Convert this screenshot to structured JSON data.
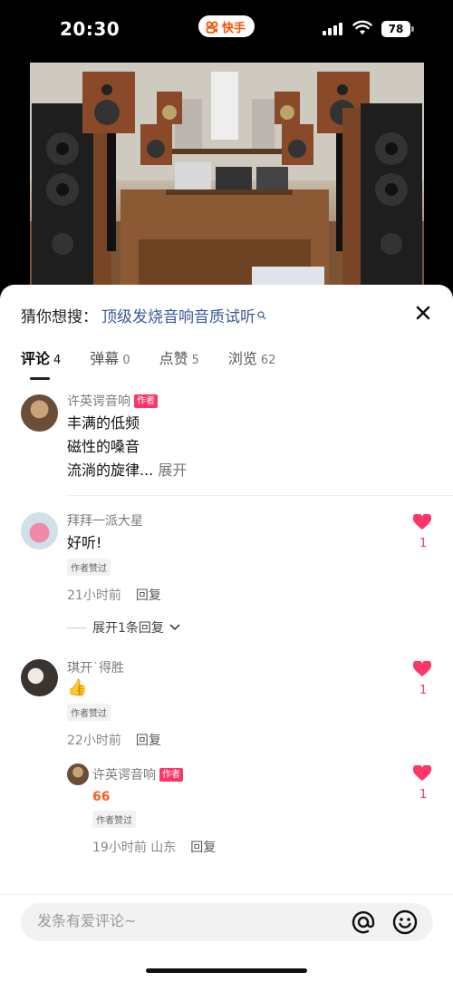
{
  "status_bar": {
    "time": "20:30",
    "app_badge": "快手",
    "battery": "78",
    "icons": [
      "signal-icon",
      "wifi-icon",
      "battery-icon"
    ]
  },
  "video": {
    "description_icon": "audio-speakers-photo"
  },
  "sheet": {
    "suggest_prefix": "猜你想搜：",
    "suggest_query": "顶级发烧音响音质试听",
    "tabs": [
      {
        "label": "评论",
        "count": "4"
      },
      {
        "label": "弹幕",
        "count": "0"
      },
      {
        "label": "点赞",
        "count": "5"
      },
      {
        "label": "浏览",
        "count": "62"
      }
    ]
  },
  "comments": [
    {
      "user": "许英谔音响",
      "author_tag": "作者",
      "lines": [
        "丰满的低频",
        "磁性的嗓音",
        "流淌的旋律..."
      ],
      "more": "展开"
    },
    {
      "user": "拜拜一派大星",
      "text": "好听!",
      "liked_tag": "作者赞过",
      "time": "21小时前",
      "reply": "回复",
      "likes": "1",
      "expand": "展开1条回复"
    },
    {
      "user": "琪开˙得胜",
      "text": "👍",
      "liked_tag": "作者赞过",
      "time": "22小时前",
      "reply": "回复",
      "likes": "1"
    },
    {
      "user": "许英谔音响",
      "author_tag": "作者",
      "text": "66",
      "liked_tag": "作者赞过",
      "time": "19小时前",
      "location": "山东",
      "reply": "回复",
      "likes": "1"
    }
  ],
  "input": {
    "placeholder": "发条有爱评论~"
  },
  "colors": {
    "accent": "#fe3666",
    "brand": "#ff5000",
    "link": "#3a5997"
  }
}
